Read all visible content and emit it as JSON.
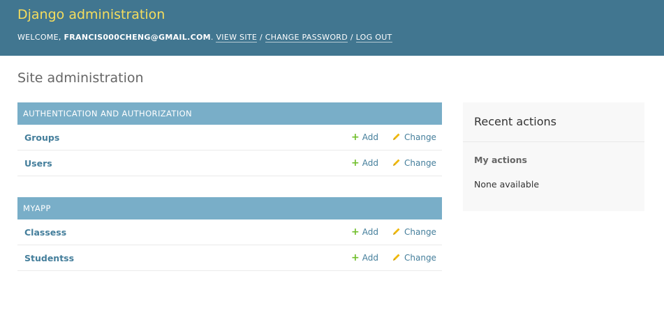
{
  "header": {
    "branding": "Django administration",
    "welcome": "WELCOME,",
    "username": "FRANCIS000CHENG@GMAIL.COM",
    "view_site": "VIEW SITE",
    "change_password": "CHANGE PASSWORD",
    "log_out": "LOG OUT",
    "separator": "/",
    "period": "."
  },
  "page": {
    "title": "Site administration"
  },
  "modules": [
    {
      "caption": "AUTHENTICATION AND AUTHORIZATION",
      "models": [
        {
          "name": "Groups",
          "add": "Add",
          "change": "Change"
        },
        {
          "name": "Users",
          "add": "Add",
          "change": "Change"
        }
      ]
    },
    {
      "caption": "MYAPP",
      "models": [
        {
          "name": "Classess",
          "add": "Add",
          "change": "Change"
        },
        {
          "name": "Studentss",
          "add": "Add",
          "change": "Change"
        }
      ]
    }
  ],
  "recent_actions": {
    "title": "Recent actions",
    "subtitle": "My actions",
    "empty_text": "None available"
  },
  "colors": {
    "header_bg": "#417690",
    "branding": "#f5dd5d",
    "module_caption_bg": "#79aec8",
    "link": "#447e9b",
    "add_icon": "#70bf2b",
    "change_icon": "#efb80b"
  },
  "icons": {
    "add": "plus-icon",
    "change": "pencil-icon"
  }
}
